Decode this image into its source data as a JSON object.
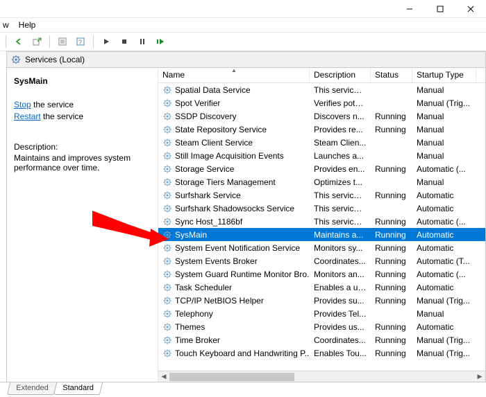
{
  "menu": {
    "view": "w",
    "help": "Help"
  },
  "header": {
    "title": "Services (Local)"
  },
  "detail": {
    "selected": "SysMain",
    "stop_link": "Stop",
    "stop_rest": " the service",
    "restart_link": "Restart",
    "restart_rest": " the service",
    "desc_label": "Description:",
    "desc_text": "Maintains and improves system performance over time."
  },
  "columns": {
    "name": "Name",
    "description": "Description",
    "status": "Status",
    "startup": "Startup Type"
  },
  "tabs": {
    "extended": "Extended",
    "standard": "Standard"
  },
  "services": [
    {
      "name": "Spatial Data Service",
      "desc": "This service ...",
      "status": "",
      "type": "Manual"
    },
    {
      "name": "Spot Verifier",
      "desc": "Verifies pote...",
      "status": "",
      "type": "Manual (Trig..."
    },
    {
      "name": "SSDP Discovery",
      "desc": "Discovers n...",
      "status": "Running",
      "type": "Manual"
    },
    {
      "name": "State Repository Service",
      "desc": "Provides re...",
      "status": "Running",
      "type": "Manual"
    },
    {
      "name": "Steam Client Service",
      "desc": "Steam Clien...",
      "status": "",
      "type": "Manual"
    },
    {
      "name": "Still Image Acquisition Events",
      "desc": "Launches a...",
      "status": "",
      "type": "Manual"
    },
    {
      "name": "Storage Service",
      "desc": "Provides en...",
      "status": "Running",
      "type": "Automatic (..."
    },
    {
      "name": "Storage Tiers Management",
      "desc": "Optimizes t...",
      "status": "",
      "type": "Manual"
    },
    {
      "name": "Surfshark Service",
      "desc": "This service ...",
      "status": "Running",
      "type": "Automatic"
    },
    {
      "name": "Surfshark Shadowsocks Service",
      "desc": "This service ...",
      "status": "",
      "type": "Automatic"
    },
    {
      "name": "Sync Host_1186bf",
      "desc": "This service ...",
      "status": "Running",
      "type": "Automatic (..."
    },
    {
      "name": "SysMain",
      "desc": "Maintains a...",
      "status": "Running",
      "type": "Automatic",
      "selected": true
    },
    {
      "name": "System Event Notification Service",
      "desc": "Monitors sy...",
      "status": "Running",
      "type": "Automatic"
    },
    {
      "name": "System Events Broker",
      "desc": "Coordinates...",
      "status": "Running",
      "type": "Automatic (T..."
    },
    {
      "name": "System Guard Runtime Monitor Bro...",
      "desc": "Monitors an...",
      "status": "Running",
      "type": "Automatic (..."
    },
    {
      "name": "Task Scheduler",
      "desc": "Enables a us...",
      "status": "Running",
      "type": "Automatic"
    },
    {
      "name": "TCP/IP NetBIOS Helper",
      "desc": "Provides su...",
      "status": "Running",
      "type": "Manual (Trig..."
    },
    {
      "name": "Telephony",
      "desc": "Provides Tel...",
      "status": "",
      "type": "Manual"
    },
    {
      "name": "Themes",
      "desc": "Provides us...",
      "status": "Running",
      "type": "Automatic"
    },
    {
      "name": "Time Broker",
      "desc": "Coordinates...",
      "status": "Running",
      "type": "Manual (Trig..."
    },
    {
      "name": "Touch Keyboard and Handwriting P...",
      "desc": "Enables Tou...",
      "status": "Running",
      "type": "Manual (Trig..."
    }
  ]
}
